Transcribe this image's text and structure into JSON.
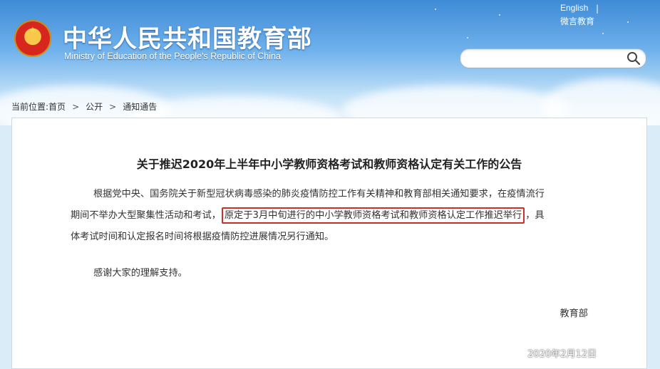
{
  "header": {
    "site_title": "中华人民共和国教育部",
    "site_subtitle": "Ministry of Education of the People's Republic of China",
    "english_link": "English",
    "divider": "|",
    "weibo_link": "微言教育",
    "search": {
      "value": "",
      "placeholder": ""
    }
  },
  "breadcrumb": {
    "prefix": "当前位置:",
    "items": [
      "首页",
      "公开",
      "通知通告"
    ],
    "separator": ">"
  },
  "article": {
    "title": "关于推迟2020年上半年中小学教师资格考试和教师资格认定有关工作的公告",
    "p1_line1": "根据党中央、国务院关于新型冠状病毒感染的肺炎疫情防控工作有关精神和教育部相关通知要求，在疫情流行",
    "p1_line2_before": "期间不举办大型聚集性活动和考试，",
    "p1_line2_highlight": "原定于3月中旬进行的中小学教师资格考试和教师资格认定工作推迟举行",
    "p1_line2_after": "，具",
    "p1_line3": "体考试时间和认定报名时间将根据疫情防控进展情况另行通知。",
    "p2": "感谢大家的理解支持。",
    "signature": "教育部",
    "date": "2020年2月12日"
  },
  "colors": {
    "highlight_border": "#c9302c",
    "sky": "#5aa3e6"
  },
  "icons": {
    "emblem": "national-emblem-icon",
    "search": "search-icon"
  }
}
